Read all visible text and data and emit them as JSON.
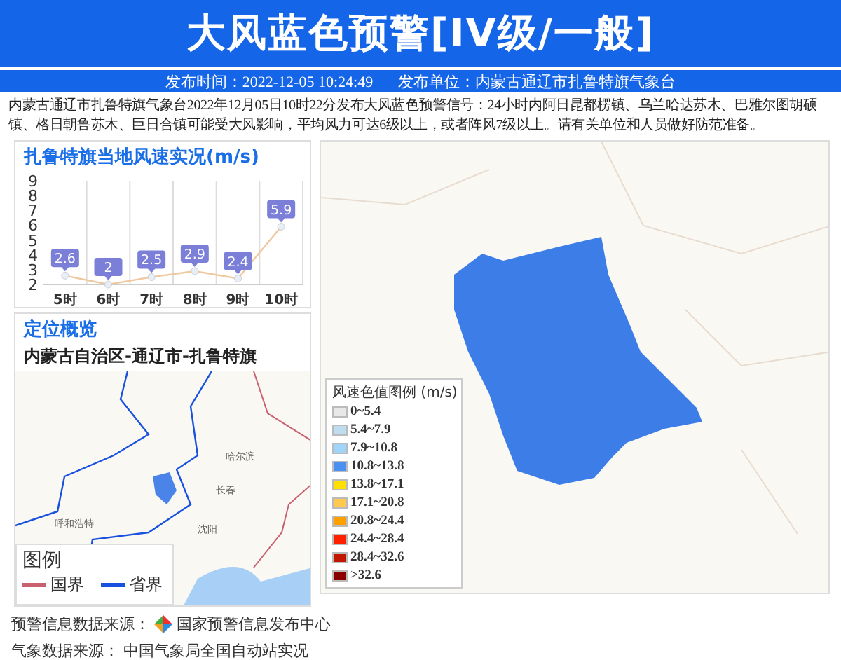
{
  "header": {
    "title": "大风蓝色预警[IV级/一般]",
    "publish_time": "发布时间：2022-12-05 10:24:49",
    "publisher": "发布单位：内蒙古通辽市扎鲁特旗气象台"
  },
  "description": "内蒙古通辽市扎鲁特旗气象台2022年12月05日10时22分发布大风蓝色预警信号：24小时内阿日昆都楞镇、乌兰哈达苏木、巴雅尔图胡硕镇、格日朝鲁苏木、巨日合镇可能受大风影响，平均风力可达6级以上，或者阵风7级以上。请有关单位和人员做好防范准备。",
  "wind_panel": {
    "title": "扎鲁特旗当地风速实况(m/s)",
    "chart_data": {
      "type": "line",
      "categories": [
        "5时",
        "6时",
        "7时",
        "8时",
        "9时",
        "10时"
      ],
      "series": [
        {
          "color": "#f0c8a0",
          "marker": "circle",
          "values": [
            2.6,
            2,
            2.5,
            2.9,
            2.4,
            5.9
          ]
        }
      ],
      "ylim": [
        2,
        9
      ],
      "yticks": [
        2,
        3,
        4,
        5,
        6,
        7,
        8,
        9
      ],
      "data_labels": true
    }
  },
  "location_panel": {
    "title": "定位概览",
    "region": "内蒙古自治区-通辽市-扎鲁特旗",
    "city_labels": [
      "哈尔滨",
      "长春",
      "沈阳",
      "呼和浩特"
    ],
    "legend": {
      "title": "图例",
      "items": [
        {
          "label": "国界",
          "color": "#c86070"
        },
        {
          "label": "省界",
          "color": "#1850e0"
        }
      ]
    }
  },
  "warning_map": {
    "legend": {
      "title": "风速色值图例 (m/s)",
      "items": [
        {
          "label": "0~5.4",
          "color": "#e8e8e8"
        },
        {
          "label": "5.4~7.9",
          "color": "#c0ddf0"
        },
        {
          "label": "7.9~10.8",
          "color": "#a0d4f8"
        },
        {
          "label": "10.8~13.8",
          "color": "#4a90f0"
        },
        {
          "label": "13.8~17.1",
          "color": "#ffe000"
        },
        {
          "label": "17.1~20.8",
          "color": "#ffc850"
        },
        {
          "label": "20.8~24.4",
          "color": "#ffa000"
        },
        {
          "label": "24.4~28.4",
          "color": "#ff2000"
        },
        {
          "label": "28.4~32.6",
          "color": "#c01800"
        },
        {
          "label": ">32.6",
          "color": "#8a0000"
        }
      ]
    }
  },
  "sources": [
    {
      "label": "预警信息数据来源：",
      "value": "国家预警信息发布中心",
      "logo": true
    },
    {
      "label": "气象数据来源：",
      "value": "中国气象局全国自动站实况",
      "logo": false
    }
  ]
}
